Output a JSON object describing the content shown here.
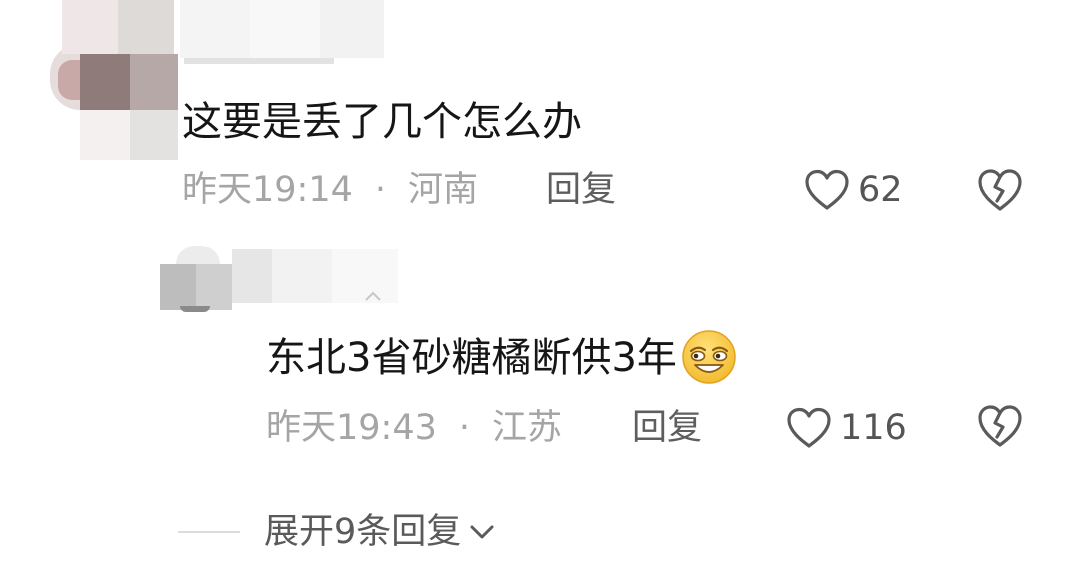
{
  "comments": [
    {
      "text": "这要是丢了几个怎么办",
      "time": "昨天19:14",
      "separator": "·",
      "location": "河南",
      "reply_label": "回复",
      "likes": "62"
    }
  ],
  "replies": [
    {
      "text": "东北3省砂糖橘断供3年",
      "emoji": "smirk-emoji",
      "time": "昨天19:43",
      "separator": "·",
      "location": "江苏",
      "reply_label": "回复",
      "likes": "116"
    }
  ],
  "expand": {
    "label": "展开9条回复",
    "icon": "chevron-down-icon"
  },
  "colors": {
    "text_primary": "#161616",
    "text_meta": "#a5a5a5",
    "text_action": "#5e5e5e",
    "icon": "#5a5a5a",
    "emoji_face": "#f6c43c"
  }
}
